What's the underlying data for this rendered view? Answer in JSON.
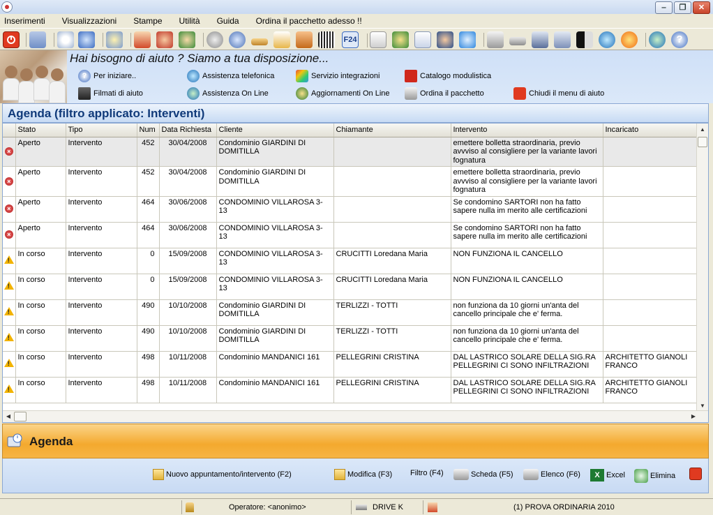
{
  "window": {
    "controls": [
      "minimize",
      "maximize",
      "close"
    ]
  },
  "menu": [
    "Inserimenti",
    "Visualizzazioni",
    "Stampe",
    "Utilità",
    "Guida",
    "Ordina il pacchetto adesso !!"
  ],
  "toolbar": {
    "f24_label": "F24"
  },
  "help": {
    "headline": "Hai bisogno di aiuto ?  Siamo a tua disposizione...",
    "links": [
      "Per iniziare..",
      "Assistenza telefonica",
      "Servizio integrazioni",
      "Catalogo modulistica",
      "Filmati di aiuto",
      "Assistenza On Line",
      "Aggiornamenti On Line",
      "Ordina il pacchetto",
      "Chiudi il menu di aiuto"
    ]
  },
  "agenda_title": "Agenda (filtro applicato: Interventi)",
  "columns": [
    "Stato",
    "Tipo",
    "Num",
    "Data Richiesta",
    "Cliente",
    "Chiamante",
    "Intervento",
    "Incaricato"
  ],
  "rows": [
    {
      "status_icon": "open",
      "stato": "Aperto",
      "tipo": "Intervento",
      "num": "452",
      "data": "30/04/2008",
      "cliente": "Condominio GIARDINI DI DOMITILLA",
      "chiamante": "",
      "intervento": "emettere bolletta straordinaria, previo avvviso al consigliere per la variante lavori fognatura",
      "incaricato": ""
    },
    {
      "status_icon": "open",
      "stato": "Aperto",
      "tipo": "Intervento",
      "num": "452",
      "data": "30/04/2008",
      "cliente": "Condominio GIARDINI DI DOMITILLA",
      "chiamante": "",
      "intervento": "emettere bolletta straordinaria, previo avvviso al consigliere per la variante lavori fognatura",
      "incaricato": ""
    },
    {
      "status_icon": "open",
      "stato": "Aperto",
      "tipo": "Intervento",
      "num": "464",
      "data": "30/06/2008",
      "cliente": "CONDOMINIO VILLAROSA 3-13",
      "chiamante": "",
      "intervento": "Se condomino SARTORI non ha fatto sapere nulla im merito alle certificazioni",
      "incaricato": ""
    },
    {
      "status_icon": "open",
      "stato": "Aperto",
      "tipo": "Intervento",
      "num": "464",
      "data": "30/06/2008",
      "cliente": "CONDOMINIO VILLAROSA 3-13",
      "chiamante": "",
      "intervento": "Se condomino SARTORI non ha fatto sapere nulla im merito alle certificazioni",
      "incaricato": ""
    },
    {
      "status_icon": "progress",
      "stato": "In corso",
      "tipo": "Intervento",
      "num": "0",
      "data": "15/09/2008",
      "cliente": "CONDOMINIO VILLAROSA 3-13",
      "chiamante": "CRUCITTI Loredana Maria",
      "intervento": "NON FUNZIONA IL CANCELLO",
      "incaricato": ""
    },
    {
      "status_icon": "progress",
      "stato": "In corso",
      "tipo": "Intervento",
      "num": "0",
      "data": "15/09/2008",
      "cliente": "CONDOMINIO VILLAROSA 3-13",
      "chiamante": "CRUCITTI Loredana Maria",
      "intervento": "NON FUNZIONA IL CANCELLO",
      "incaricato": ""
    },
    {
      "status_icon": "progress",
      "stato": "In corso",
      "tipo": "Intervento",
      "num": "490",
      "data": "10/10/2008",
      "cliente": "Condominio GIARDINI DI DOMITILLA",
      "chiamante": "TERLIZZI - TOTTI",
      "intervento": "non funziona da 10 giorni un'anta del cancello principale che e' ferma.",
      "incaricato": ""
    },
    {
      "status_icon": "progress",
      "stato": "In corso",
      "tipo": "Intervento",
      "num": "490",
      "data": "10/10/2008",
      "cliente": "Condominio GIARDINI DI DOMITILLA",
      "chiamante": "TERLIZZI - TOTTI",
      "intervento": "non funziona da 10 giorni un'anta del cancello principale che e' ferma.",
      "incaricato": ""
    },
    {
      "status_icon": "progress",
      "stato": "In corso",
      "tipo": "Intervento",
      "num": "498",
      "data": "10/11/2008",
      "cliente": "Condominio MANDANICI 161",
      "chiamante": "PELLEGRINI CRISTINA",
      "intervento": "DAL LASTRICO SOLARE DELLA SIG.RA PELLEGRINI     CI SONO INFILTRAZIONI",
      "incaricato": "ARCHITETTO GIANOLI FRANCO"
    },
    {
      "status_icon": "progress",
      "stato": "In corso",
      "tipo": "Intervento",
      "num": "498",
      "data": "10/11/2008",
      "cliente": "Condominio MANDANICI 161",
      "chiamante": "PELLEGRINI CRISTINA",
      "intervento": "DAL LASTRICO SOLARE DELLA SIG.RA PELLEGRINI     CI SONO INFILTRAZIONI",
      "incaricato": "ARCHITETTO GIANOLI FRANCO"
    }
  ],
  "section_title": "Agenda",
  "actions": {
    "new": "Nuovo appuntamento/intervento (F2)",
    "edit": "Modifica (F3)",
    "filter": "Filtro (F4)",
    "card": "Scheda (F5)",
    "list": "Elenco (F6)",
    "excel": "Excel",
    "delete": "Elimina"
  },
  "status": {
    "operator": "Operatore: <anonimo>",
    "drive": "DRIVE K",
    "company": "(1) PROVA  ORDINARIA 2010"
  },
  "colors": {
    "accent_blue": "#103a7a",
    "section_orange": "#f4a92e",
    "status_open": "#c62828",
    "status_progress": "#f2b300"
  }
}
